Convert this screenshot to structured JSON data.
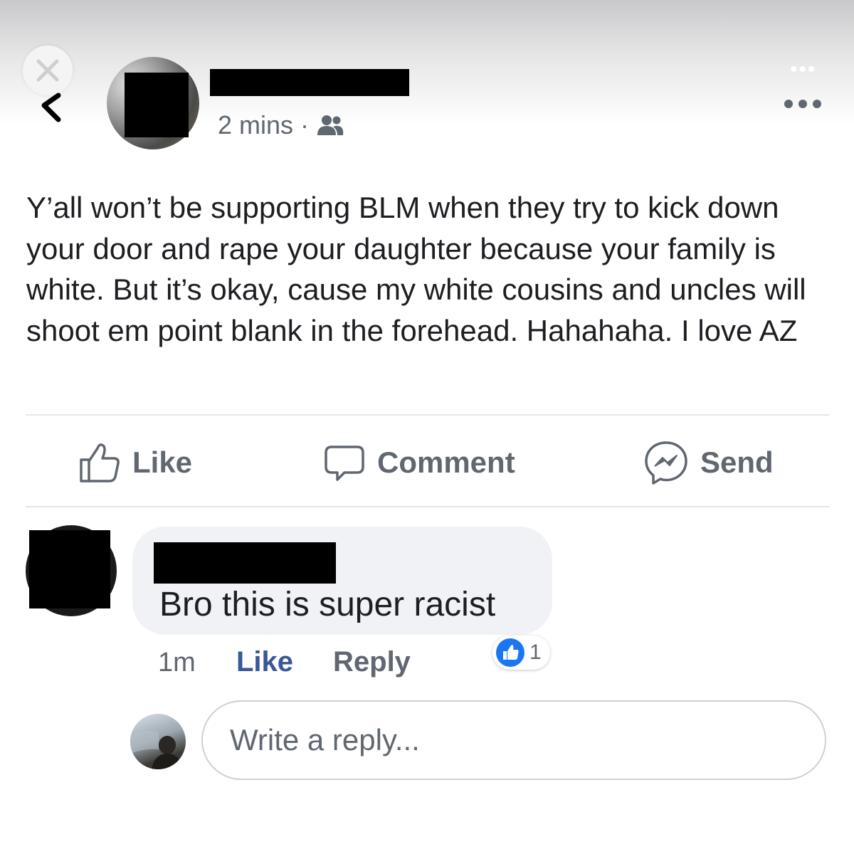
{
  "header": {
    "author_name": "",
    "timestamp": "2 mins",
    "separator": "·",
    "audience_icon": "friends-icon",
    "close_icon": "close-icon",
    "back_icon": "chevron-left-icon",
    "more_icon": "more-horizontal-icon"
  },
  "post": {
    "text": "Y’all won’t be supporting BLM when they try to kick down your door and rape your daughter because your family is white. But it’s okay, cause my white cousins and uncles will shoot em point blank in the forehead. Hahahaha. I love AZ"
  },
  "actions": [
    {
      "label": "Like",
      "icon": "thumbs-up-icon"
    },
    {
      "label": "Comment",
      "icon": "comment-bubble-icon"
    },
    {
      "label": "Send",
      "icon": "messenger-icon"
    }
  ],
  "comment": {
    "author_name": "",
    "text": "Bro this is super racist",
    "time": "1m",
    "like_label": "Like",
    "reply_label": "Reply",
    "reaction_icon": "like-reaction-icon",
    "reaction_count": "1"
  },
  "reply_box": {
    "placeholder": "Write a reply..."
  },
  "colors": {
    "link_blue": "#385898",
    "like_blue": "#1877f2",
    "secondary_text": "#606770",
    "bubble_bg": "#f0f2f5"
  }
}
